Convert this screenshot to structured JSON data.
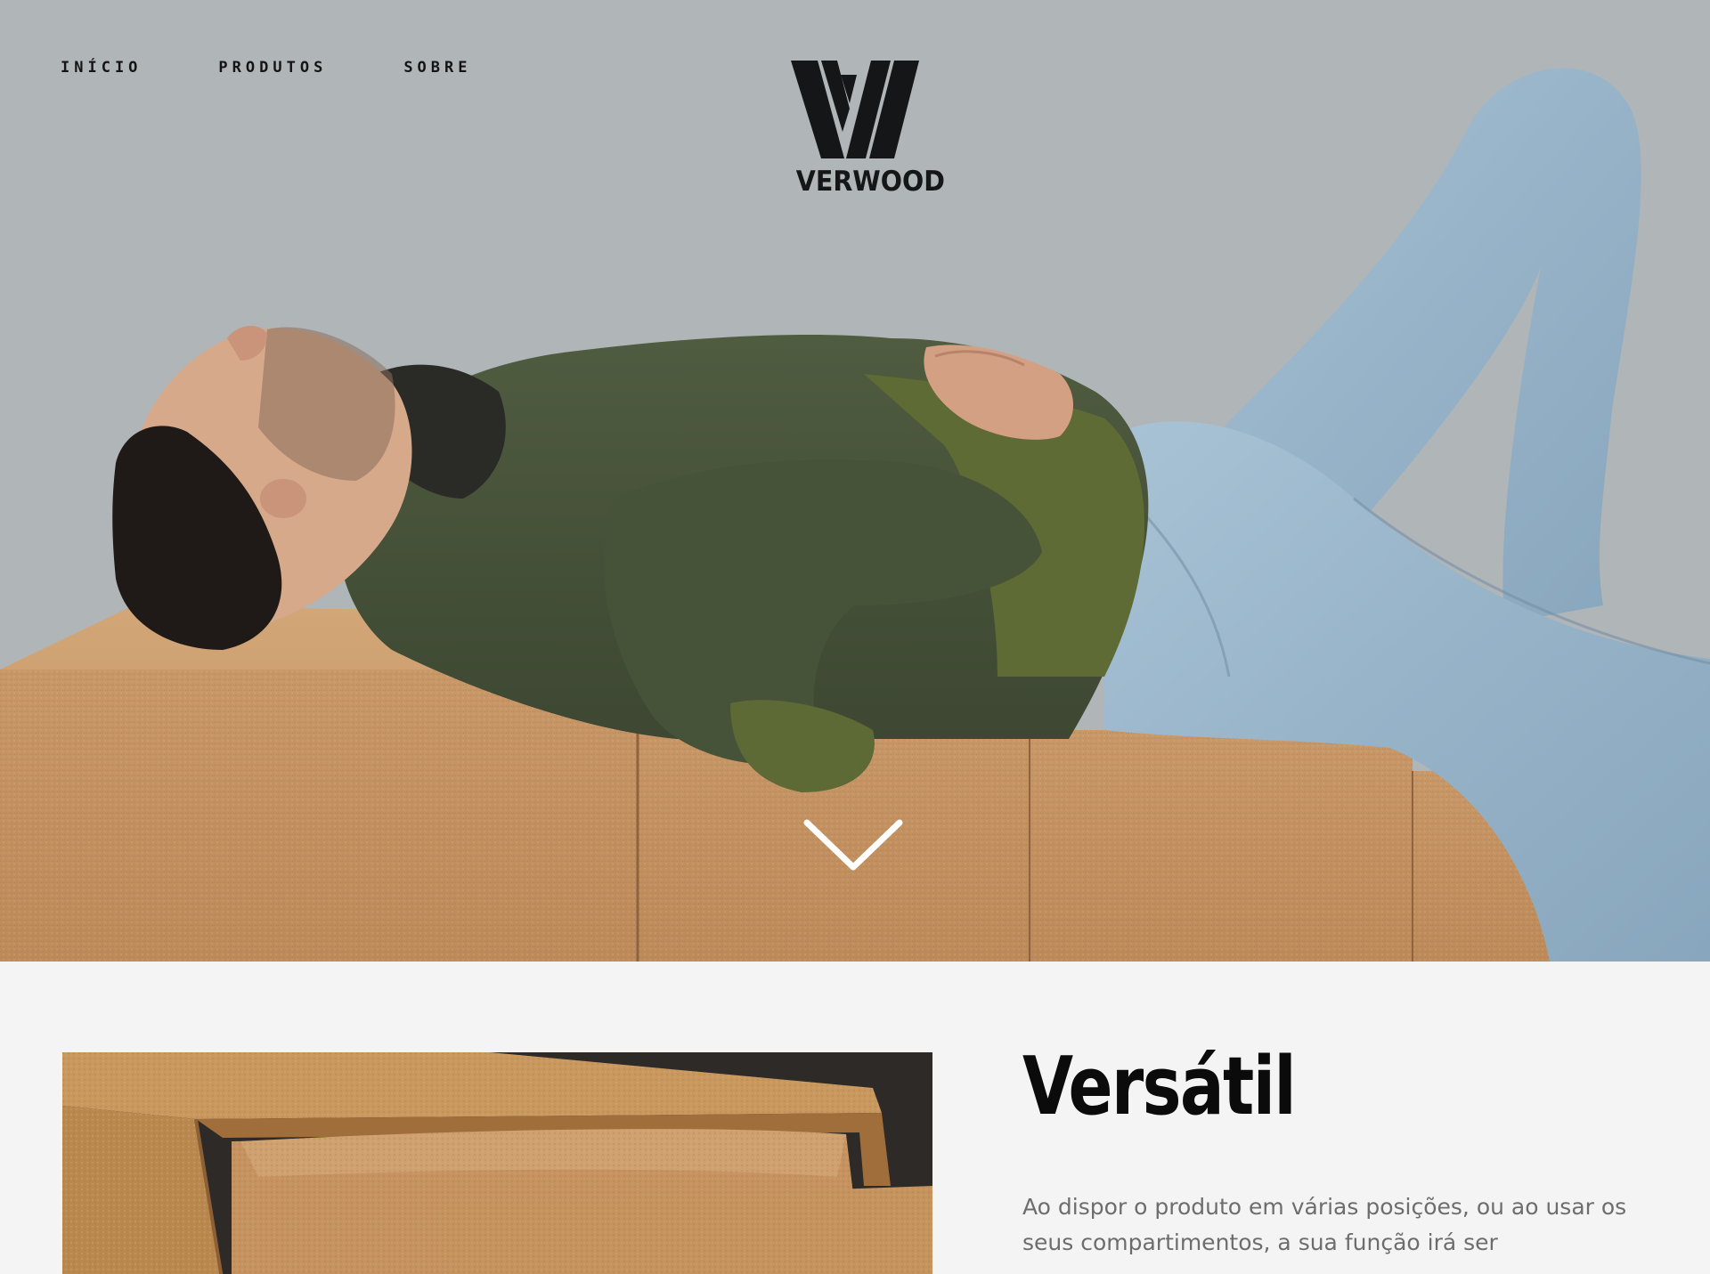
{
  "nav": {
    "items": [
      {
        "label": "INÍCIO"
      },
      {
        "label": "PRODUTOS"
      },
      {
        "label": "SOBRE"
      }
    ]
  },
  "brand": {
    "name": "VERWOOD",
    "logo_icon": "w-logo-icon"
  },
  "hero": {
    "scroll_icon": "chevron-down-icon"
  },
  "feature": {
    "title": "Versátil",
    "text": "Ao dispor o produto em várias posições, ou ao usar os seus compartimentos, a sua função irá ser"
  },
  "colors": {
    "text_dark": "#141414",
    "cork": "#c9925c",
    "background": "#f4f4f4",
    "body_text": "#6d6d6d"
  }
}
